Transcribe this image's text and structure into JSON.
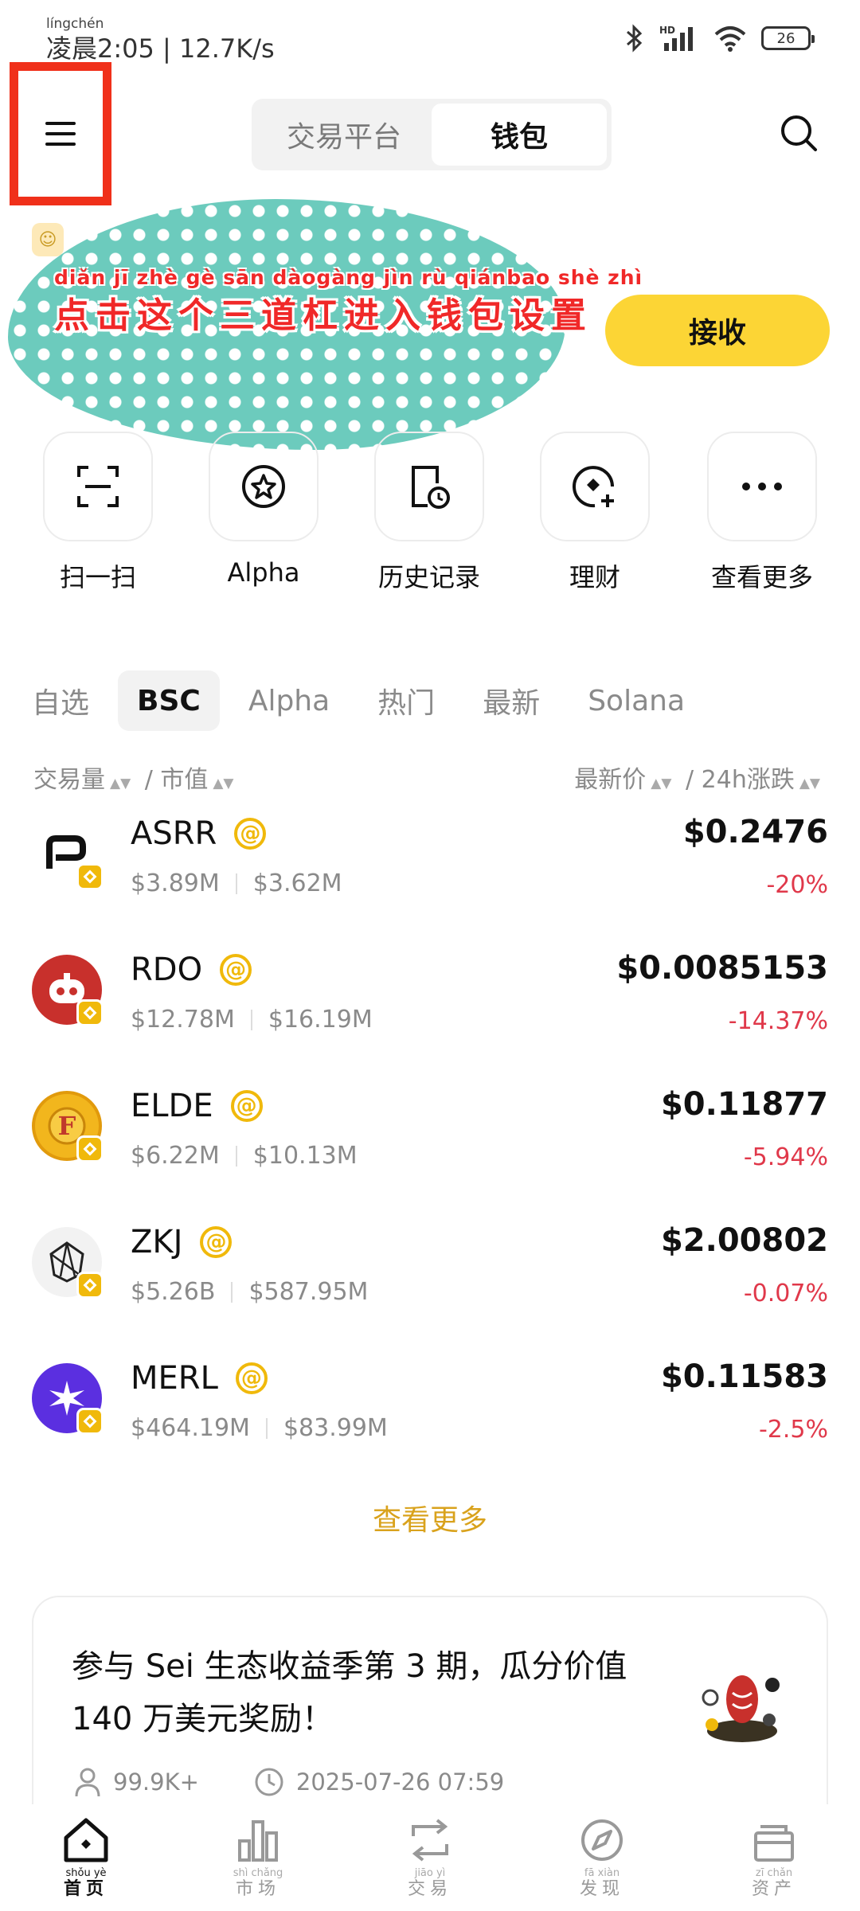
{
  "status_bar": {
    "time_pinyin": "língchén",
    "time": "凌晨2:05 | 12.7K/s",
    "battery": "26"
  },
  "header": {
    "segments": [
      "交易平台",
      "钱包"
    ],
    "active_segment": "钱包"
  },
  "annotation": {
    "pinyin": "diǎn jī zhè gè sān dàogàng jìn rù qiánbao shè zhì",
    "text": "点击这个三道杠进入钱包设置"
  },
  "receive_button": "接收",
  "quick_actions": [
    {
      "label": "扫一扫",
      "icon": "scan-icon"
    },
    {
      "label": "Alpha",
      "icon": "alpha-star-icon"
    },
    {
      "label": "历史记录",
      "icon": "history-icon"
    },
    {
      "label": "理财",
      "icon": "earn-icon"
    },
    {
      "label": "查看更多",
      "icon": "more-icon"
    }
  ],
  "tabs": [
    "自选",
    "BSC",
    "Alpha",
    "热门",
    "最新",
    "Solana"
  ],
  "active_tab": "BSC",
  "sort": {
    "volume": "交易量",
    "slash": "/",
    "market_cap": "市值",
    "price": "最新价",
    "change": "24h涨跌"
  },
  "tokens": [
    {
      "symbol": "ASRR",
      "volume": "$3.89M",
      "market_cap": "$3.62M",
      "price": "$0.2476",
      "change": "-20%",
      "icon": "asrr-logo"
    },
    {
      "symbol": "RDO",
      "volume": "$12.78M",
      "market_cap": "$16.19M",
      "price": "$0.0085153",
      "change": "-14.37%",
      "icon": "rdo-logo"
    },
    {
      "symbol": "ELDE",
      "volume": "$6.22M",
      "market_cap": "$10.13M",
      "price": "$0.11877",
      "change": "-5.94%",
      "icon": "elde-logo"
    },
    {
      "symbol": "ZKJ",
      "volume": "$5.26B",
      "market_cap": "$587.95M",
      "price": "$2.00802",
      "change": "-0.07%",
      "icon": "zkj-logo"
    },
    {
      "symbol": "MERL",
      "volume": "$464.19M",
      "market_cap": "$83.99M",
      "price": "$0.11583",
      "change": "-2.5%",
      "icon": "merl-logo"
    }
  ],
  "see_more": "查看更多",
  "campaign": {
    "title": "参与 Sei 生态收益季第 3 期，瓜分价值 140 万美元奖励！",
    "participants": "99.9K+",
    "date": "2025-07-26 07:59"
  },
  "bottom_nav": [
    {
      "pinyin": "shǒu yè",
      "label": "首页",
      "active": true
    },
    {
      "pinyin": "shì chǎng",
      "label": "市场",
      "active": false
    },
    {
      "pinyin": "jiāo yì",
      "label": "交易",
      "active": false
    },
    {
      "pinyin": "fā xiàn",
      "label": "发现",
      "active": false
    },
    {
      "pinyin": "zī chǎn",
      "label": "资产",
      "active": false
    }
  ],
  "colors": {
    "brand_yellow": "#fcd535",
    "negative_red": "#e0384a",
    "annotation_red": "#f02828",
    "highlight_box": "#f0301a",
    "see_more_gold": "#d9a21c"
  }
}
